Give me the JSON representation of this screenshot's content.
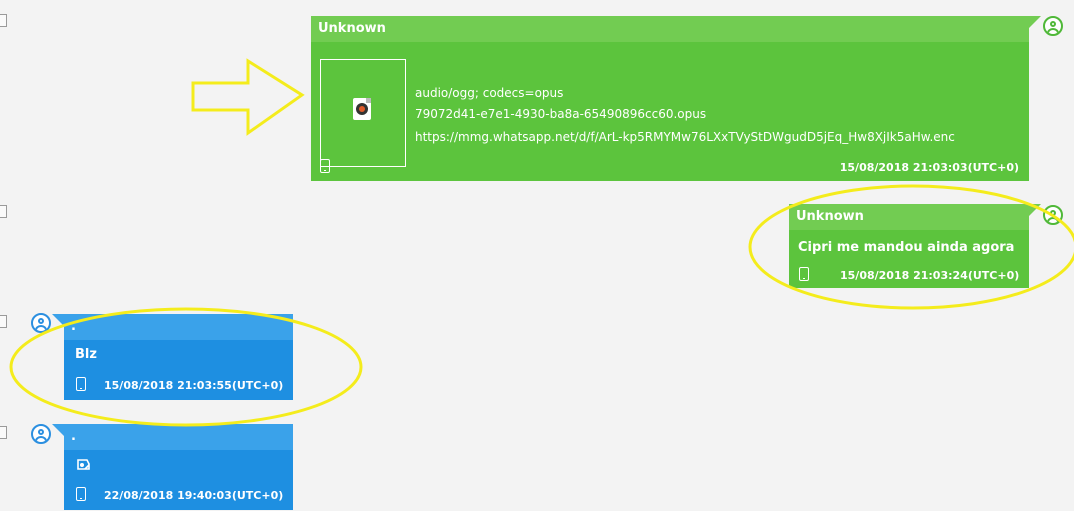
{
  "messages": [
    {
      "sender": "Unknown",
      "attachment": {
        "mime": "audio/ogg; codecs=opus",
        "filename": "79072d41-e7e1-4930-ba8a-65490896cc60.opus",
        "url": "https://mmg.whatsapp.net/d/f/ArL-kp5RMYMw76LXxTVyStDWgudD5jEq_Hw8XjIk5aHw.enc",
        "icon": "audio-file-icon"
      },
      "timestamp": "15/08/2018 21:03:03(UTC+0)",
      "color": "#5cc43d"
    },
    {
      "sender": "Unknown",
      "text": "Cipri me mandou ainda agora",
      "timestamp": "15/08/2018 21:03:24(UTC+0)",
      "color": "#5cc43d"
    },
    {
      "sender": ".",
      "text": "Blz",
      "timestamp": "15/08/2018 21:03:55(UTC+0)",
      "color": "#1e8fe1"
    },
    {
      "sender": ".",
      "sticker_icon": "sticker-icon",
      "timestamp": "22/08/2018 19:40:03(UTC+0)",
      "color": "#1e8fe1"
    }
  ],
  "annotation_color": "#f4ec1c"
}
